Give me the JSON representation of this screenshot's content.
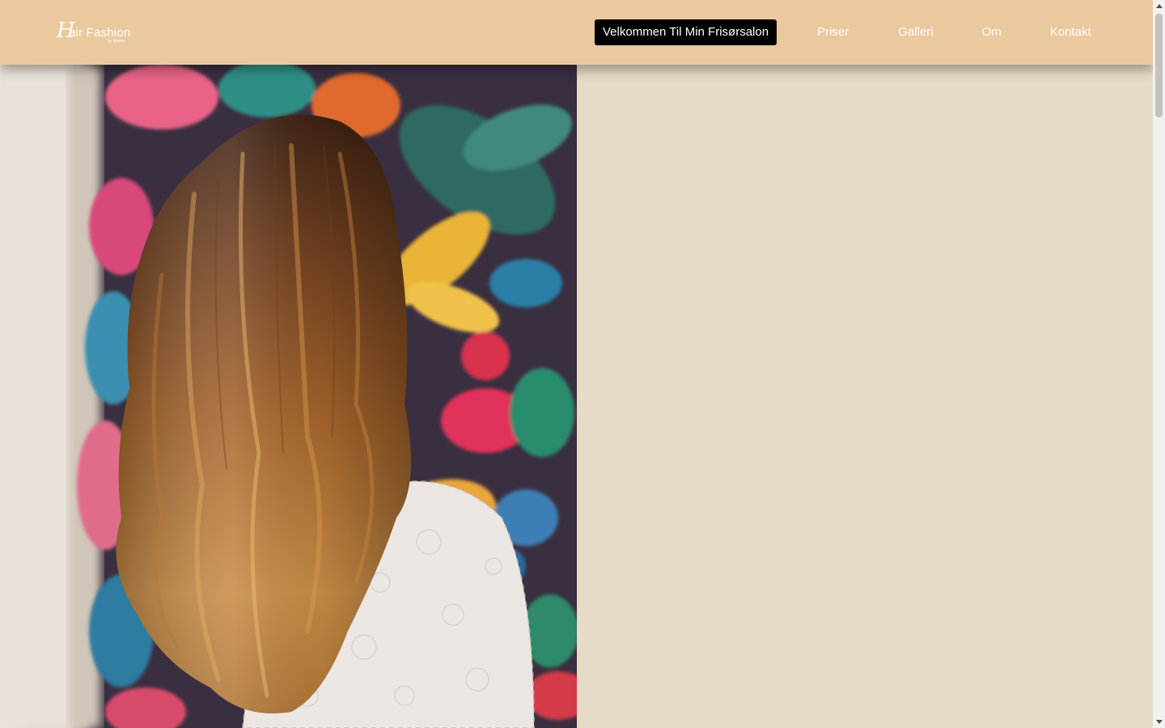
{
  "brand": {
    "script_letter": "H",
    "name": "air Fashion",
    "tagline": "by Karina"
  },
  "nav": {
    "items": [
      {
        "label": "Velkommen Til Min Frisørsalon",
        "active": true
      },
      {
        "label": "Priser",
        "active": false
      },
      {
        "label": "Galleri",
        "active": false
      },
      {
        "label": "Om",
        "active": false
      },
      {
        "label": "Kontakt",
        "active": false
      }
    ]
  },
  "colors": {
    "header_bg": "#ebc99e",
    "page_bg": "#e6dac8",
    "active_nav_bg": "#000000",
    "nav_text": "#ffffff"
  },
  "hero": {
    "image": "photo of long wavy balayage hair in front of tropical floral wallpaper"
  }
}
